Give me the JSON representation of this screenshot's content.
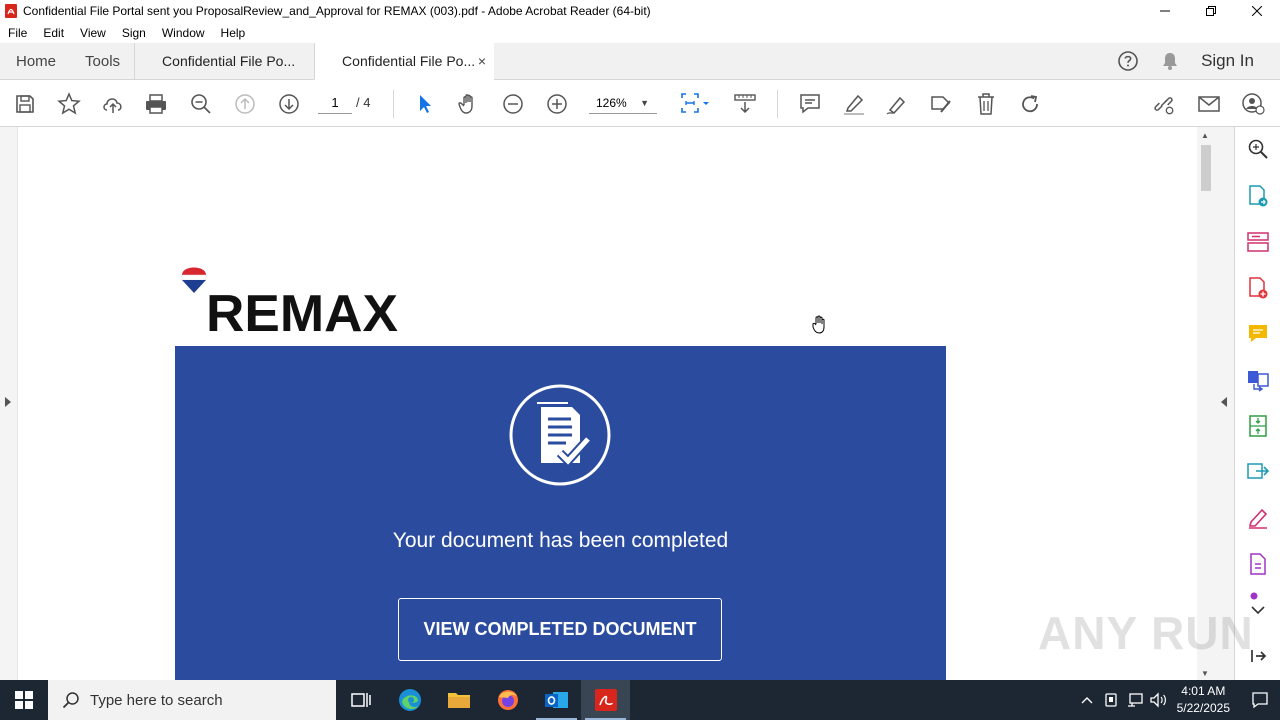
{
  "window": {
    "title": "Confidential File Portal sent you ProposalReview_and_Approval for REMAX (003).pdf - Adobe Acrobat Reader (64-bit)"
  },
  "menu": [
    "File",
    "Edit",
    "View",
    "Sign",
    "Window",
    "Help"
  ],
  "nav": {
    "home": "Home",
    "tools": "Tools"
  },
  "tabs": [
    {
      "label": "Confidential File Po..."
    },
    {
      "label": "Confidential File Po...",
      "close": "×"
    }
  ],
  "header_right": {
    "sign_in": "Sign In"
  },
  "toolbar": {
    "page_current": "1",
    "page_total": "/ 4",
    "zoom": "126%"
  },
  "document": {
    "logo_text": "REMAX",
    "completed_message": "Your document has been completed",
    "button_label": "VIEW COMPLETED DOCUMENT",
    "brand_blue": "#2a4b9e"
  },
  "watermark": "ANY RUN",
  "taskbar": {
    "search_placeholder": "Type here to search",
    "time": "4:01 AM",
    "date": "5/22/2025"
  }
}
